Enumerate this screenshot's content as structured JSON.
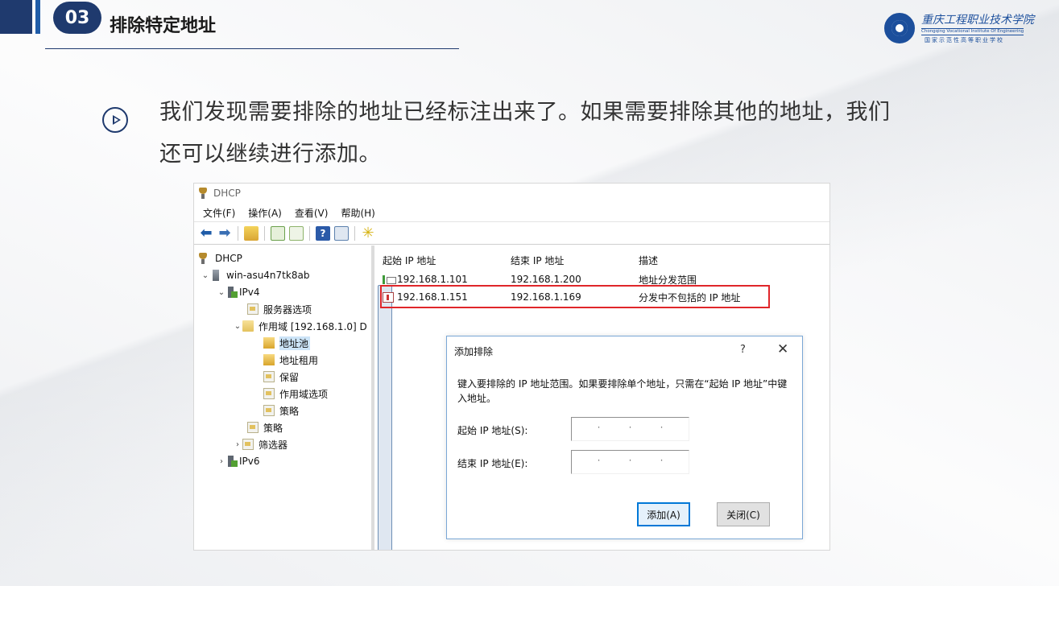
{
  "slide": {
    "section_number": "03",
    "section_title": "排除特定地址",
    "logo_cn": "重庆工程职业技术学院",
    "logo_en": "Chongqing Vocational Institute Of Engineering",
    "logo_sub": "国家示范性高等职业学校",
    "paragraph": "我们发现需要排除的地址已经标注出来了。如果需要排除其他的地址，我们还可以继续进行添加。"
  },
  "window": {
    "title": "DHCP",
    "menu": [
      "文件(F)",
      "操作(A)",
      "查看(V)",
      "帮助(H)"
    ],
    "toolbar_icons": [
      "back-arrow-icon",
      "forward-arrow-icon",
      "up-folder-icon",
      "show-tree-icon",
      "refresh-icon",
      "export-list-icon",
      "help-icon",
      "properties-icon",
      "new-item-star-icon"
    ]
  },
  "tree": {
    "root": "DHCP",
    "server": "win-asu4n7tk8ab",
    "ipv4": "IPv4",
    "server_options": "服务器选项",
    "scope": "作用域 [192.168.1.0] D",
    "address_pool": "地址池",
    "address_leases": "地址租用",
    "reservations": "保留",
    "scope_options": "作用域选项",
    "scope_policies": "策略",
    "policies": "策略",
    "filters": "筛选器",
    "ipv6": "IPv6"
  },
  "list": {
    "columns": [
      "起始 IP 地址",
      "结束 IP 地址",
      "描述"
    ],
    "rows": [
      {
        "start": "192.168.1.101",
        "end": "192.168.1.200",
        "desc": "地址分发范围"
      },
      {
        "start": "192.168.1.151",
        "end": "192.168.1.169",
        "desc": "分发中不包括的 IP 地址"
      }
    ]
  },
  "dialog": {
    "title": "添加排除",
    "help": "?",
    "close": "✕",
    "description": "键入要排除的 IP 地址范围。如果要排除单个地址，只需在“起始 IP 地址”中键入地址。",
    "start_label": "起始 IP 地址(S):",
    "end_label": "结束 IP 地址(E):",
    "ip_placeholder_dot": "·",
    "add_button": "添加(A)",
    "close_button": "关闭(C)"
  },
  "colors": {
    "brand_navy": "#1f3a6e",
    "brand_blue": "#1f5ca8",
    "highlight_red": "#e0262a",
    "selection": "#cce4f7"
  }
}
